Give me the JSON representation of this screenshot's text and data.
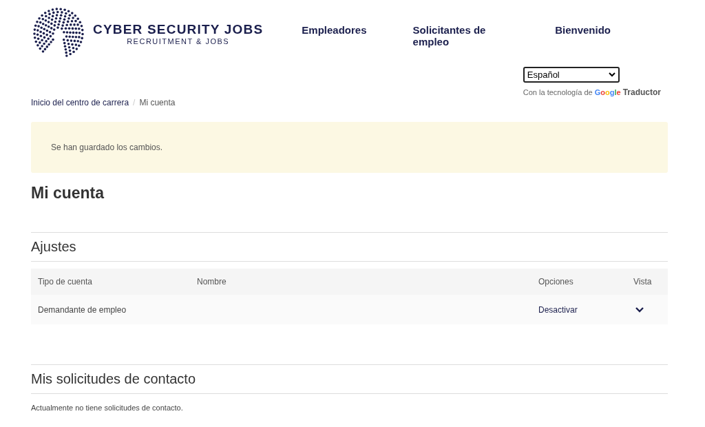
{
  "logo": {
    "title": "CYBER SECURITY JOBS",
    "subtitle": "RECRUITMENT & JOBS"
  },
  "nav": [
    "Empleadores",
    "Solicitantes de empleo",
    "Bienvenido"
  ],
  "translate": {
    "value": "Español",
    "powered_by": "Con la tecnología de",
    "google": "Google",
    "service": "Traductor"
  },
  "breadcrumb": [
    {
      "label": "Inicio del centro de carrera"
    },
    {
      "label": "Mi cuenta"
    }
  ],
  "breadcrumb_separator": "/",
  "alert": "Se han guardado los cambios.",
  "title": "Mi cuenta",
  "settings": {
    "heading": "Ajustes",
    "columns": [
      "Tipo de cuenta",
      "Nombre",
      "Opciones",
      "Vista"
    ],
    "rows": [
      {
        "type": "Demandante de empleo",
        "name": "",
        "action": "Desactivar",
        "expanded": false
      }
    ]
  },
  "contacts": {
    "heading": "Mis solicitudes de contacto",
    "empty": "Actualmente no tiene solicitudes de contacto."
  }
}
